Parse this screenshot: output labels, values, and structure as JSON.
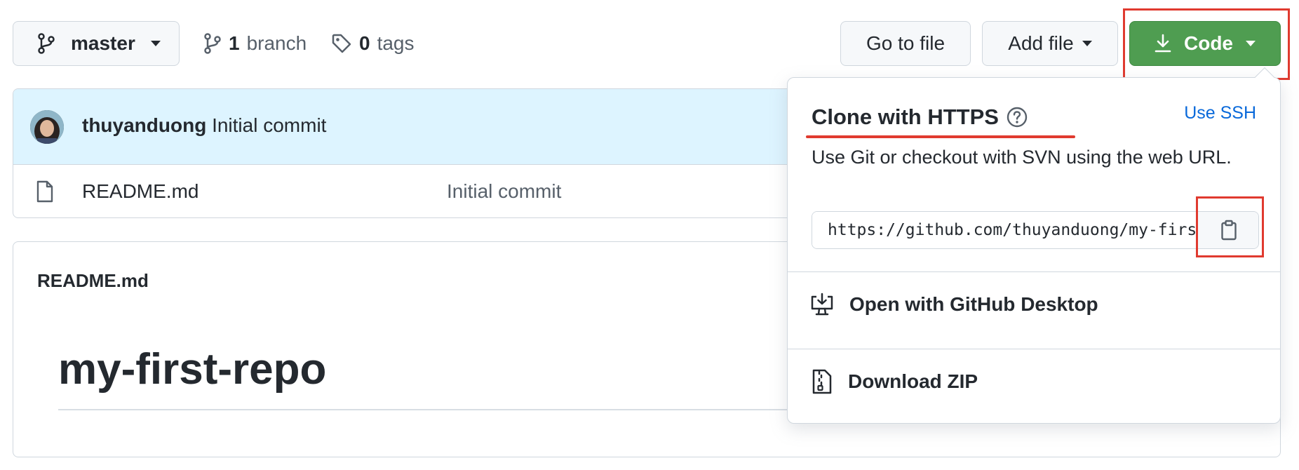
{
  "toolbar": {
    "branch_button": "master",
    "branches_count": "1",
    "branches_label": "branch",
    "tags_count": "0",
    "tags_label": "tags",
    "go_to_file": "Go to file",
    "add_file": "Add file",
    "code": "Code"
  },
  "commit": {
    "author": "thuyanduong",
    "message": "Initial commit"
  },
  "files": [
    {
      "name": "README.md",
      "commit_message": "Initial commit"
    }
  ],
  "readme": {
    "header": "README.md",
    "title": "my-first-repo"
  },
  "clone": {
    "title": "Clone with HTTPS",
    "use_ssh": "Use SSH",
    "help_text": "Use Git or checkout with SVN using the web URL.",
    "url": "https://github.com/thuyanduong/my-first-repo.git",
    "open_desktop": "Open with GitHub Desktop",
    "download_zip": "Download ZIP"
  },
  "colors": {
    "code_button": "#4f9d51",
    "annotation_red": "#e03a2f",
    "link_blue": "#0969da",
    "commit_bar": "#ddf4ff"
  }
}
